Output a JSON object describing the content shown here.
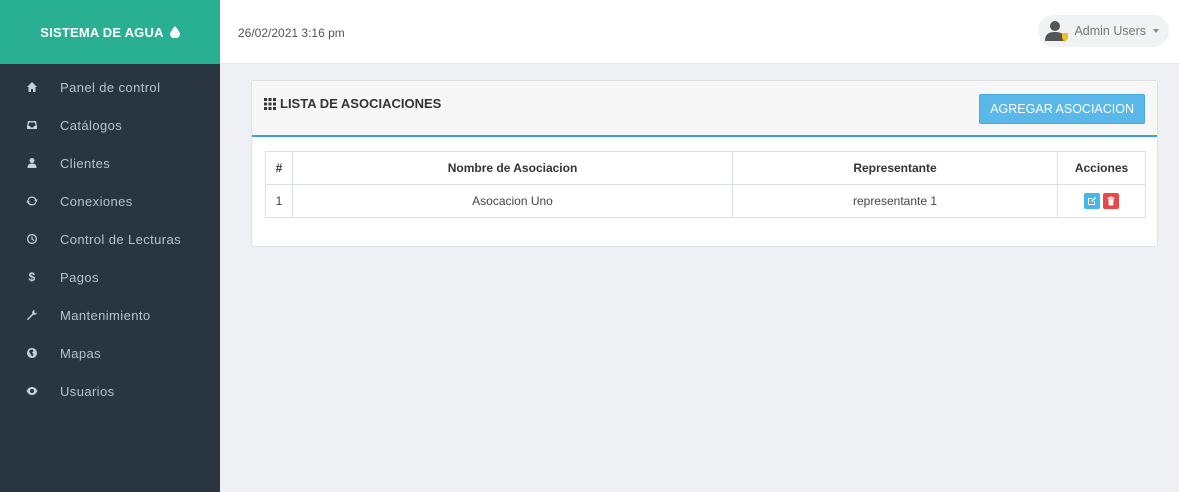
{
  "brand": {
    "title": "SISTEMA DE AGUA",
    "icon": "water-drop-icon"
  },
  "header": {
    "datetime": "26/02/2021 3:16 pm",
    "user_label": "Admin Users"
  },
  "sidebar": {
    "items": [
      {
        "label": "Panel de control",
        "icon": "home-icon"
      },
      {
        "label": "Catálogos",
        "icon": "inbox-icon"
      },
      {
        "label": "Clientes",
        "icon": "user-icon"
      },
      {
        "label": "Conexiones",
        "icon": "refresh-icon"
      },
      {
        "label": "Control de Lecturas",
        "icon": "clock-icon"
      },
      {
        "label": "Pagos",
        "icon": "dollar-icon"
      },
      {
        "label": "Mantenimiento",
        "icon": "wrench-icon"
      },
      {
        "label": "Mapas",
        "icon": "globe-icon"
      },
      {
        "label": "Usuarios",
        "icon": "eye-icon"
      }
    ]
  },
  "panel": {
    "title": "LISTA DE ASOCIACIONES",
    "add_button": "AGREGAR ASOCIACION",
    "columns": [
      "#",
      "Nombre de Asociacion",
      "Representante",
      "Acciones"
    ],
    "rows": [
      {
        "num": "1",
        "name": "Asocacion Uno",
        "representative": "representante 1"
      }
    ]
  },
  "colors": {
    "sidebar": "#2a3542",
    "brand": "#29b093",
    "accent": "#3c9ee0",
    "edit": "#45b6e6",
    "delete": "#e84a4a"
  }
}
